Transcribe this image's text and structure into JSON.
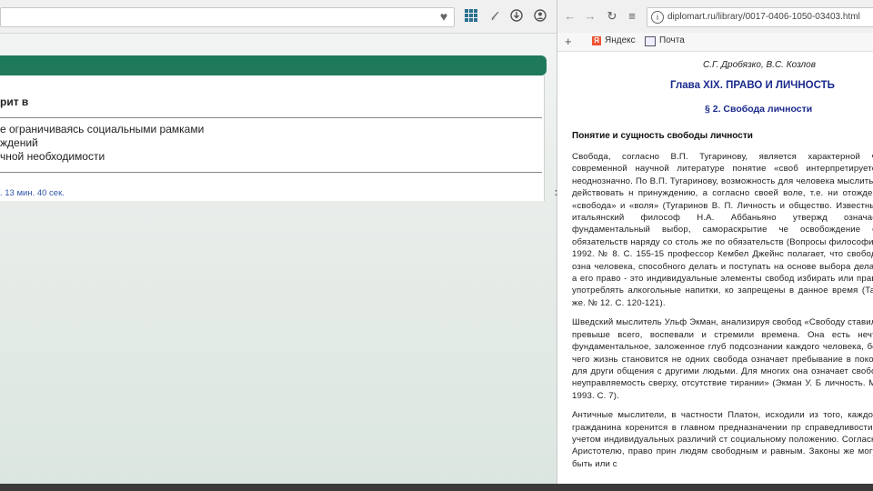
{
  "left_window": {
    "heading": "рит в",
    "list": [
      "е ограничиваясь социальными рамками",
      "ждений",
      "чной необходимости"
    ],
    "timer": ". 13 мин. 40 сек."
  },
  "right_window": {
    "url": "diplomart.ru/library/0017-0406-1050-03403.html",
    "bookmarks": [
      "Яндекс",
      "Почта"
    ],
    "document": {
      "authors": "С.Г. Дробязко, В.С. Козлов",
      "chapter": "Глава XIX. ПРАВО И ЛИЧНОСТЬ",
      "section": "§ 2. Свобода личности",
      "subheading": "Понятие и сущность свободы личности",
      "paragraphs": [
        "Свобода, согласно В.П. Тугаринову, является характерной че современной научной литературе понятие «своб интерпретируется неоднозначно. По В.П. Тугаринову, возможность для человека мыслить и действовать н принуждению, а согласно своей воле, т.е. ни отождест «свобода» и «воля» (Тугаринов В. П. Личность и общество. Известный итальянский философ Н.А. Аббаньяно утвержд означает фундаментальный выбор, самораскрытие че освобождение от обязательств наряду со столь же по обязательств (Вопросы философии. 1992. № 8. С. 155-15 профессор Кембел Джейнс полагает, что свобода озна человека, способного делать и поступать на основе выбора делах, а его право - это индивидуальные элементы свобод избирать или право употреблять алкогольные напитки, ко запрещены в данное время (Там же. № 12. С. 120-121).",
        "Шведский мыслитель Ульф Экман, анализируя свобод «Свободу ставили превыше всего, воспевали и стремили времена. Она есть нечто фундаментальное, заложенное глуб подсознании каждого человека, без чего жизнь становится не одних свобода означает пребывание в покое, для други общения с другими людьми. Для многих она означает свобод неуправляемость сверху, отсутствие тирании» (Экман У. Б личность. М., 1993. С. 7).",
        "Античные мыслители, в частности Платон, исходили из того, каждого гражданина коренится в главном предназначении пр справедливости с учетом индивидуальных различий ст социальному положению. Согласно Аристотелю, право прин людям свободным и равным. Законы же могут быть или с"
      ]
    }
  },
  "colors": {
    "green_bar": "#1e7a5a",
    "chapter_blue": "#1a2a8c",
    "timer_blue": "#2f57a8"
  }
}
